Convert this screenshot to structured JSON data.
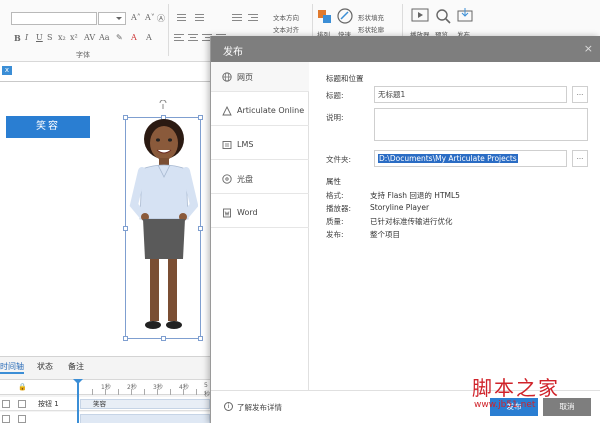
{
  "ribbon": {
    "font_group_label": "字体",
    "text_direction": "文本方向",
    "text_align": "文本对齐",
    "shape_fill": "形状填充",
    "shape_outline": "形状轮廓",
    "arrange_label": "排列",
    "quick_styles_label": "快速",
    "preview_label": "预览",
    "publish_label": "发布",
    "player_label": "播放器"
  },
  "canvas": {
    "button_label": "笑容"
  },
  "timeline": {
    "tabs": [
      "时间轴",
      "状态",
      "备注"
    ],
    "active_tab": 0,
    "ticks": [
      "1秒",
      "2秒",
      "3秒",
      "4秒",
      "5秒"
    ],
    "rows": [
      {
        "label": "按钮 1",
        "bar": "笑容"
      },
      {
        "label": "",
        "bar": ""
      }
    ]
  },
  "dialog": {
    "title": "发布",
    "close": "×",
    "sidebar": [
      {
        "label": "网页",
        "icon": "globe-icon"
      },
      {
        "label": "Articulate Online",
        "icon": "articulate-icon"
      },
      {
        "label": "LMS",
        "icon": "lms-icon"
      },
      {
        "label": "光盘",
        "icon": "disc-icon"
      },
      {
        "label": "Word",
        "icon": "word-icon"
      }
    ],
    "section_title_location": "标题和位置",
    "title_label": "标题:",
    "title_value": "无标题1",
    "description_label": "说明:",
    "description_value": "",
    "folder_label": "文件夹:",
    "folder_value": "D:\\Documents\\My Articulate Projects",
    "browse": "...",
    "properties_title": "属性",
    "properties": [
      {
        "label": "格式:",
        "value": "支持 Flash 回退的 HTML5"
      },
      {
        "label": "播放器:",
        "value": "Storyline Player"
      },
      {
        "label": "质量:",
        "value": "已针对标准传输进行优化"
      },
      {
        "label": "发布:",
        "value": "整个项目"
      }
    ],
    "footer_link": "了解发布详情",
    "publish_button": "发布",
    "cancel_button": "取消"
  },
  "watermark": {
    "brand_main": "脚本之家",
    "brand_url": "www.jb51.net"
  }
}
